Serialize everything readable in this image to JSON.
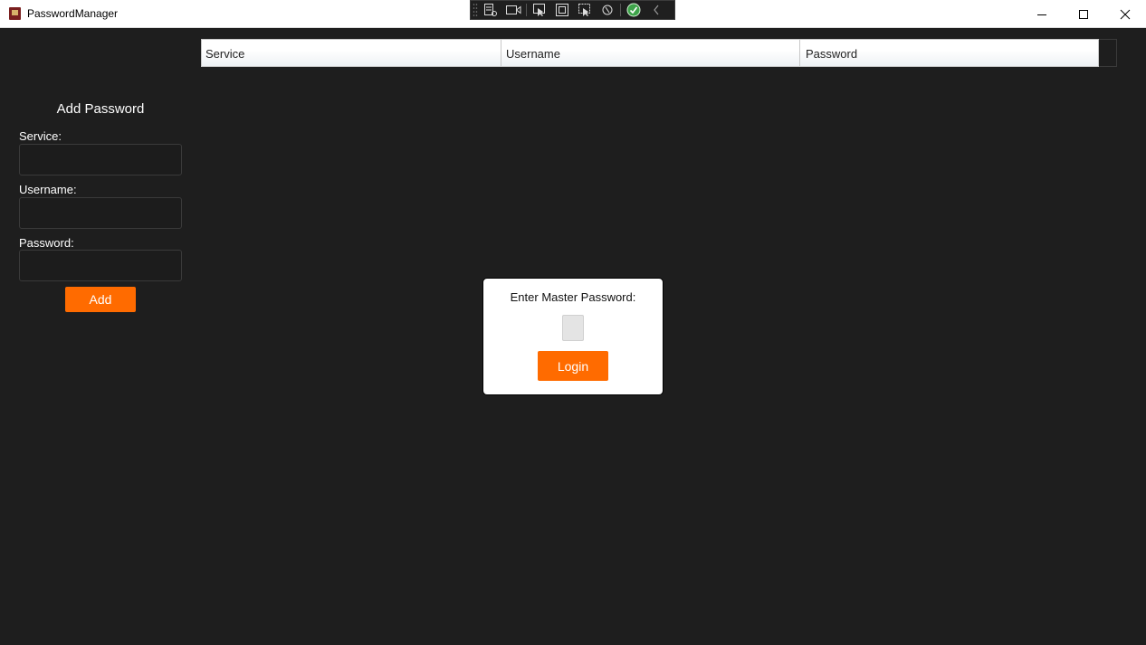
{
  "window": {
    "title": "PasswordManager",
    "minimize_icon": "minimize-icon",
    "maximize_icon": "maximize-icon",
    "close_icon": "close-icon"
  },
  "debug_toolbar": {
    "items": [
      "live-visual-tree-icon",
      "record-icon",
      "select-element-icon",
      "display-layout-adorners-icon",
      "track-focused-element-icon",
      "hot-reload-icon",
      "check-icon",
      "collapse-chevron-icon"
    ]
  },
  "form": {
    "title": "Add Password",
    "service_label": "Service:",
    "username_label": "Username:",
    "password_label": "Password:",
    "service_value": "",
    "username_value": "",
    "password_value": "",
    "add_label": "Add"
  },
  "grid": {
    "columns": [
      "Service",
      "Username",
      "Password"
    ]
  },
  "login": {
    "prompt": "Enter Master Password:",
    "password_value": "",
    "button_label": "Login"
  },
  "colors": {
    "accent": "#ff6b00",
    "background": "#1e1e1e",
    "dialog": "#ffffff"
  }
}
